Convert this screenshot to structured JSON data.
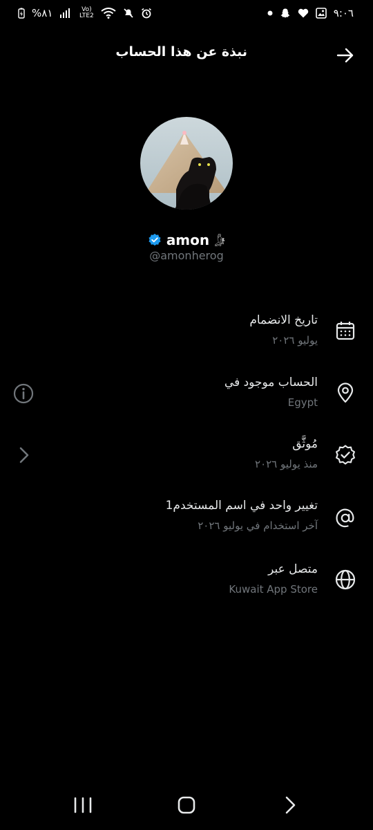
{
  "status_bar": {
    "battery": "%٨١",
    "network": "Vo) LTE2",
    "time": "٩:٠٦"
  },
  "header": {
    "title": "نبذة عن هذا الحساب"
  },
  "profile": {
    "display_name": "amon",
    "name_emoji": "𓀏",
    "handle": "@amonherog",
    "verified": true
  },
  "info_rows": [
    {
      "label": "تاريخ الانضمام",
      "sub": "يوليو ٢٠٢٦",
      "icon": "calendar-icon"
    },
    {
      "label": "الحساب موجود في",
      "sub": "Egypt",
      "icon": "location-pin-icon"
    },
    {
      "label": "مُوثَّق",
      "sub": "منذ يوليو ٢٠٢٦",
      "icon": "verified-badge-outline-icon"
    },
    {
      "label": "تغيير واحد في اسم المستخدم1",
      "sub": "آخر استخدام في يوليو ٢٠٢٦",
      "icon": "at-sign-icon"
    },
    {
      "label": "متصل عبر",
      "sub": "Kuwait App Store",
      "icon": "globe-icon"
    }
  ],
  "colors": {
    "background": "#000000",
    "text_primary": "#e7e9ea",
    "text_secondary": "#71767b",
    "verified_blue": "#1d9bf0"
  }
}
